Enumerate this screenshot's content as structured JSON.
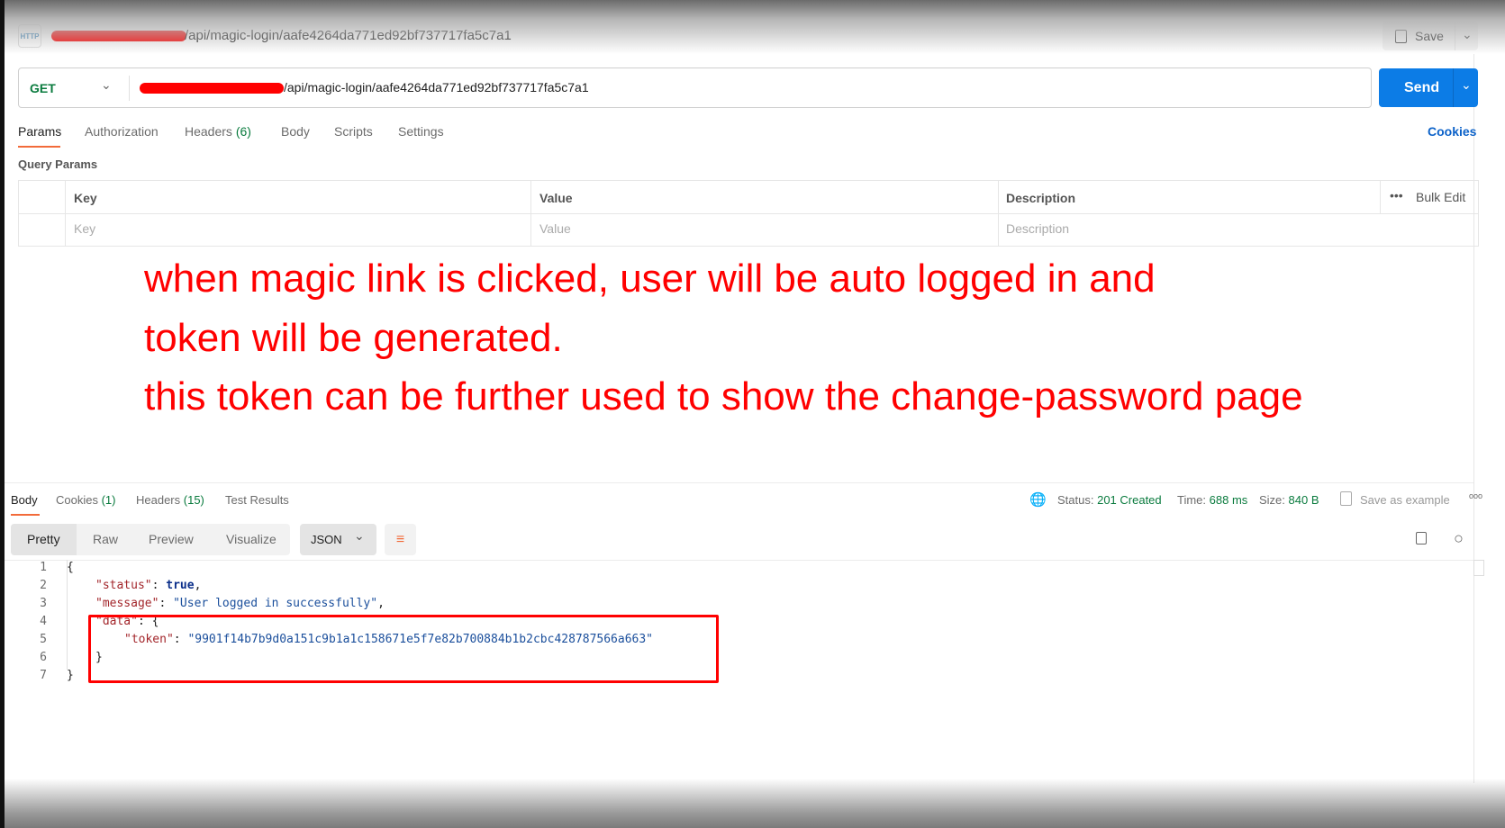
{
  "header": {
    "icon": "http-icon",
    "icon_label": "HTTP",
    "title_path": "/api/magic-login/aafe4264da771ed92bf737717fa5c7a1",
    "save_label": "Save"
  },
  "request": {
    "method": "GET",
    "url_path": "/api/magic-login/aafe4264da771ed92bf737717fa5c7a1",
    "send_label": "Send"
  },
  "tabs": [
    {
      "label": "Params",
      "active": true
    },
    {
      "label": "Authorization"
    },
    {
      "label": "Headers",
      "count": "(6)"
    },
    {
      "label": "Body"
    },
    {
      "label": "Scripts"
    },
    {
      "label": "Settings"
    }
  ],
  "cookies_link": "Cookies",
  "query_params": {
    "title": "Query Params",
    "columns": [
      "Key",
      "Value",
      "Description"
    ],
    "bulk_edit": "Bulk Edit",
    "placeholders": [
      "Key",
      "Value",
      "Description"
    ]
  },
  "annotation": [
    "when magic link is clicked, user will be auto logged in and",
    "token will be generated.",
    "this token can be further used to show the change-password page"
  ],
  "response": {
    "tabs": [
      {
        "label": "Body",
        "active": true
      },
      {
        "label": "Cookies",
        "count": "(1)"
      },
      {
        "label": "Headers",
        "count": "(15)"
      },
      {
        "label": "Test Results"
      }
    ],
    "status_label": "Status:",
    "status": "201 Created",
    "time_label": "Time:",
    "time": "688 ms",
    "size_label": "Size:",
    "size": "840 B",
    "save_example": "Save as example",
    "views": [
      "Pretty",
      "Raw",
      "Preview",
      "Visualize"
    ],
    "format": "JSON",
    "lines": [
      "1",
      "2",
      "3",
      "4",
      "5",
      "6",
      "7"
    ],
    "body": {
      "status_key": "\"status\"",
      "status_val": "true",
      "message_key": "\"message\"",
      "message_val": "\"User logged in successfully\"",
      "data_key": "\"data\"",
      "token_key": "\"token\"",
      "token_val": "\"9901f14b7b9d0a151c9b1a1c158671e5f7e82b700884b1b2cbc428787566a663\""
    }
  },
  "colors": {
    "accent": "#0c7ce6",
    "tab_underline": "#f26b3a",
    "success": "#0a7b3e",
    "annotation": "#ff0000"
  }
}
